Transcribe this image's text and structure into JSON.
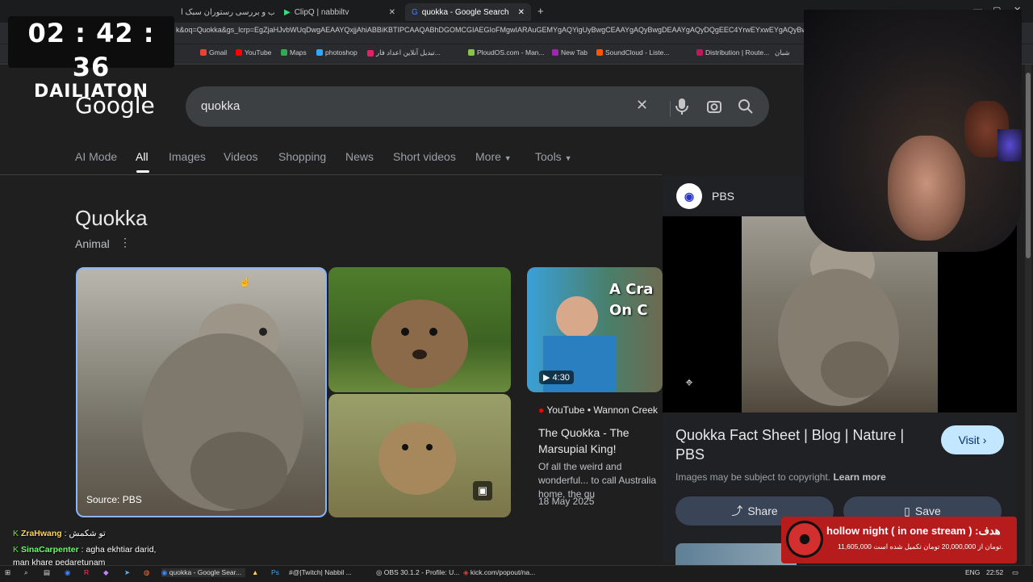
{
  "tabs": [
    {
      "label": "اسباب و بررسی رستوران سبک ا"
    },
    {
      "label": "ClipQ | nabbiltv"
    },
    {
      "label": "quokka - Google Search"
    }
  ],
  "url": "k&oq=Quokka&gs_lcrp=EgZjaHJvbWUqDwgAEAAYQxjjAhiABBiKBTIPCAAQABhDGOMCGIAEGIoFMgwIARAuGEMYgAQYigUyBwgCEAAYgAQyBwgDEAAYgAQyDQgEEC4YrwEYxwEYgAQyBwgFEA",
  "bookmarks": [
    "Gmail",
    "YouTube",
    "Maps",
    "photoshop",
    "تبدیل آنلاین اعداد فار...",
    "PloudOS.com - Man...",
    "New Tab",
    "SoundCloud - Liste...",
    "Distribution | Route...",
    "شبان"
  ],
  "timer": {
    "time": "02 : 42 : 36",
    "label": "DAILIATON"
  },
  "google": {
    "logo": "Google",
    "query": "quokka"
  },
  "search_tabs": [
    "AI Mode",
    "All",
    "Images",
    "Videos",
    "Shopping",
    "News",
    "Short videos",
    "More",
    "Tools"
  ],
  "knowledge": {
    "title": "Quokka",
    "subtitle": "Animal"
  },
  "image_source": "Source: PBS",
  "video": {
    "thumb_text": "A Cra\nOn C",
    "duration": "4:30",
    "source": "YouTube • Wannon Creek",
    "title": "The Quokka - The Marsupial King!",
    "desc": "Of all the weird and wonderful... to call Australia home, the qu",
    "date": "18 May 2025"
  },
  "panel": {
    "source": "PBS",
    "title": "Quokka Fact Sheet | Blog | Nature | PBS",
    "visit": "Visit",
    "copyright": "Images may be subject to copyright.",
    "learn_more": "Learn more",
    "share": "Share",
    "save": "Save"
  },
  "chat": [
    {
      "user": "ZraHwang",
      "msg": ": تو شکمش"
    },
    {
      "user": "SinaCarpenter",
      "msg": ": agha ekhtiar darid,"
    },
    {
      "user": "",
      "msg": "man khare pedaretunam"
    }
  ],
  "donation": {
    "line1": "hollow night ( in one stream ) :هدف",
    "line2": "11,605,000 تومان از 20,000,000 تومان تکمیل شده است."
  },
  "taskbar": [
    "quokka - Google Sear...",
    "#@|Twitch| Nabbil ...",
    "OBS 30.1.2 - Profile: U...",
    "kick.com/popout/na..."
  ],
  "tray": {
    "lang": "ENG",
    "time": "22:52"
  }
}
